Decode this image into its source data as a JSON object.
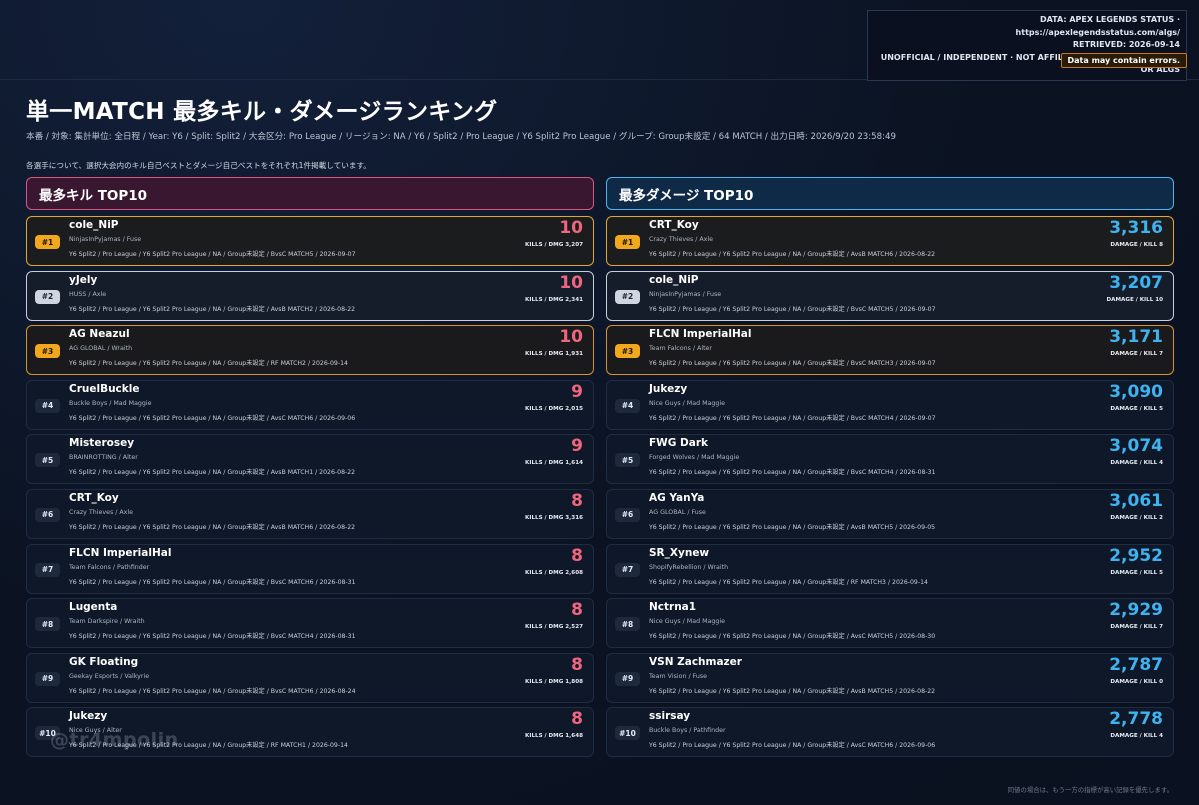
{
  "source": {
    "line1": "DATA: APEX LEGENDS STATUS · https://apexlegendsstatus.com/algs/",
    "line2": "RETRIEVED: 2026-09-14",
    "line3": "UNOFFICIAL / INDEPENDENT · NOT AFFILIATED WITH EA, RESPAWN OR ALGS",
    "warning": "Data may contain errors."
  },
  "title": "単一MATCH 最多キル・ダメージランキング",
  "meta": "本番 / 対象: 集計単位: 全日程 / Year: Y6 / Split: Split2 / 大会区分: Pro League / リージョン: NA / Y6 / Split2 / Pro League / Y6 Split2 Pro League / グループ: Group未設定 / 64 MATCH / 出力日時: 2026/9/20 23:58:49",
  "note": "各選手について、選択大会内のキル自己ベストとダメージ自己ベストをそれぞれ1件掲載しています。",
  "kills": {
    "heading": "最多キル TOP10",
    "rows": [
      {
        "rank": "#1",
        "name": "cole_NiP",
        "team": "NinjasInPyjamas / Fuse",
        "info": "Y6 Split2 / Pro League / Y6 Split2 Pro League / NA / Group未設定 / BvsC MATCH5 / 2026-09-07",
        "value": "10",
        "sub": "KILLS / DMG 3,207"
      },
      {
        "rank": "#2",
        "name": "yJely",
        "team": "HUSS / Axle",
        "info": "Y6 Split2 / Pro League / Y6 Split2 Pro League / NA / Group未設定 / AvsB MATCH2 / 2026-08-22",
        "value": "10",
        "sub": "KILLS / DMG 2,341"
      },
      {
        "rank": "#3",
        "name": "AG Neazul",
        "team": "AG GLOBAL / Wraith",
        "info": "Y6 Split2 / Pro League / Y6 Split2 Pro League / NA / Group未設定 / RF MATCH2 / 2026-09-14",
        "value": "10",
        "sub": "KILLS / DMG 1,931"
      },
      {
        "rank": "#4",
        "name": "CruelBuckle",
        "team": "Buckle Boys / Mad Maggie",
        "info": "Y6 Split2 / Pro League / Y6 Split2 Pro League / NA / Group未設定 / AvsC MATCH6 / 2026-09-06",
        "value": "9",
        "sub": "KILLS / DMG 2,015"
      },
      {
        "rank": "#5",
        "name": "Misterosey",
        "team": "BRAINROTTING / Alter",
        "info": "Y6 Split2 / Pro League / Y6 Split2 Pro League / NA / Group未設定 / AvsB MATCH1 / 2026-08-22",
        "value": "9",
        "sub": "KILLS / DMG 1,614"
      },
      {
        "rank": "#6",
        "name": "CRT_Koy",
        "team": "Crazy Thieves / Axle",
        "info": "Y6 Split2 / Pro League / Y6 Split2 Pro League / NA / Group未設定 / AvsB MATCH6 / 2026-08-22",
        "value": "8",
        "sub": "KILLS / DMG 3,316"
      },
      {
        "rank": "#7",
        "name": "FLCN ImperialHal",
        "team": "Team Falcons / Pathfinder",
        "info": "Y6 Split2 / Pro League / Y6 Split2 Pro League / NA / Group未設定 / BvsC MATCH6 / 2026-08-31",
        "value": "8",
        "sub": "KILLS / DMG 2,608"
      },
      {
        "rank": "#8",
        "name": "Lugenta",
        "team": "Team Darkspire / Wraith",
        "info": "Y6 Split2 / Pro League / Y6 Split2 Pro League / NA / Group未設定 / BvsC MATCH4 / 2026-08-31",
        "value": "8",
        "sub": "KILLS / DMG 2,527"
      },
      {
        "rank": "#9",
        "name": "GK Floating",
        "team": "Geekay Esports / Valkyrie",
        "info": "Y6 Split2 / Pro League / Y6 Split2 Pro League / NA / Group未設定 / BvsC MATCH6 / 2026-08-24",
        "value": "8",
        "sub": "KILLS / DMG 1,808"
      },
      {
        "rank": "#10",
        "name": "Jukezy",
        "team": "Nice Guys / Alter",
        "info": "Y6 Split2 / Pro League / Y6 Split2 Pro League / NA / Group未設定 / RF MATCH1 / 2026-09-14",
        "value": "8",
        "sub": "KILLS / DMG 1,648"
      }
    ]
  },
  "damage": {
    "heading": "最多ダメージ TOP10",
    "rows": [
      {
        "rank": "#1",
        "name": "CRT_Koy",
        "team": "Crazy Thieves / Axle",
        "info": "Y6 Split2 / Pro League / Y6 Split2 Pro League / NA / Group未設定 / AvsB MATCH6 / 2026-08-22",
        "value": "3,316",
        "sub": "DAMAGE / KILL 8"
      },
      {
        "rank": "#2",
        "name": "cole_NiP",
        "team": "NinjasInPyjamas / Fuse",
        "info": "Y6 Split2 / Pro League / Y6 Split2 Pro League / NA / Group未設定 / BvsC MATCH5 / 2026-09-07",
        "value": "3,207",
        "sub": "DAMAGE / KILL 10"
      },
      {
        "rank": "#3",
        "name": "FLCN ImperialHal",
        "team": "Team Falcons / Alter",
        "info": "Y6 Split2 / Pro League / Y6 Split2 Pro League / NA / Group未設定 / BvsC MATCH3 / 2026-09-07",
        "value": "3,171",
        "sub": "DAMAGE / KILL 7"
      },
      {
        "rank": "#4",
        "name": "Jukezy",
        "team": "Nice Guys / Mad Maggie",
        "info": "Y6 Split2 / Pro League / Y6 Split2 Pro League / NA / Group未設定 / BvsC MATCH4 / 2026-09-07",
        "value": "3,090",
        "sub": "DAMAGE / KILL 5"
      },
      {
        "rank": "#5",
        "name": "FWG Dark",
        "team": "Forged Wolves / Mad Maggie",
        "info": "Y6 Split2 / Pro League / Y6 Split2 Pro League / NA / Group未設定 / BvsC MATCH4 / 2026-08-31",
        "value": "3,074",
        "sub": "DAMAGE / KILL 4"
      },
      {
        "rank": "#6",
        "name": "AG YanYa",
        "team": "AG GLOBAL / Fuse",
        "info": "Y6 Split2 / Pro League / Y6 Split2 Pro League / NA / Group未設定 / AvsB MATCH5 / 2026-09-05",
        "value": "3,061",
        "sub": "DAMAGE / KILL 2"
      },
      {
        "rank": "#7",
        "name": "SR_Xynew",
        "team": "ShopifyRebellion / Wraith",
        "info": "Y6 Split2 / Pro League / Y6 Split2 Pro League / NA / Group未設定 / RF MATCH3 / 2026-09-14",
        "value": "2,952",
        "sub": "DAMAGE / KILL 5"
      },
      {
        "rank": "#8",
        "name": "Nctrna1",
        "team": "Nice Guys / Mad Maggie",
        "info": "Y6 Split2 / Pro League / Y6 Split2 Pro League / NA / Group未設定 / AvsC MATCH5 / 2026-08-30",
        "value": "2,929",
        "sub": "DAMAGE / KILL 7"
      },
      {
        "rank": "#9",
        "name": "VSN Zachmazer",
        "team": "Team Vision / Fuse",
        "info": "Y6 Split2 / Pro League / Y6 Split2 Pro League / NA / Group未設定 / AvsB MATCH5 / 2026-08-22",
        "value": "2,787",
        "sub": "DAMAGE / KILL 0"
      },
      {
        "rank": "#10",
        "name": "ssirsay",
        "team": "Buckle Boys / Pathfinder",
        "info": "Y6 Split2 / Pro League / Y6 Split2 Pro League / NA / Group未設定 / AvsC MATCH6 / 2026-09-06",
        "value": "2,778",
        "sub": "DAMAGE / KILL 4"
      }
    ]
  },
  "watermark": "@tr4mpolin",
  "footnote": "同値の場合は、もう一方の指標が高い記録を優先します。",
  "colors": {
    "kill_accent": "#f0667e",
    "damage_accent": "#3fb2f0",
    "gold": "#f2a81d",
    "silver": "#cfd6e0"
  }
}
